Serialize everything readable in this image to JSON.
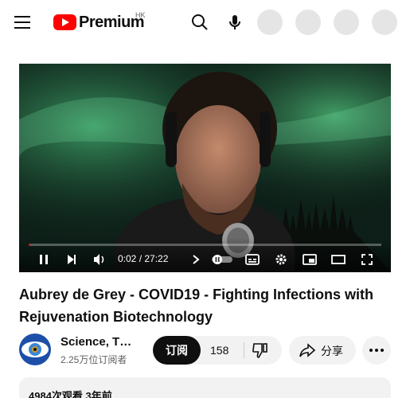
{
  "header": {
    "logo_text": "Premium",
    "region": "HK",
    "icons": [
      "menu-icon",
      "search-icon",
      "mic-icon"
    ]
  },
  "player": {
    "time": "0:02 / 27:22",
    "progress": 0.001,
    "icons": [
      "pause-icon",
      "next-icon",
      "volume-icon",
      "autoplay-toggle-icon",
      "captions-icon",
      "settings-icon",
      "miniplayer-icon",
      "theater-icon",
      "fullscreen-icon"
    ],
    "accent": "#ff0000"
  },
  "video": {
    "title": "Aubrey de Grey - COVID19 - Fighting Infections with Rejuvenation Biotechnology"
  },
  "channel": {
    "name": "Science, T…",
    "subscribers": "2.25万位订阅者",
    "subscribe_label": "订阅"
  },
  "actions": {
    "like_count": "158",
    "share_label": "分享"
  },
  "description": {
    "meta": "4984次观看  3年前"
  },
  "colors": {
    "brand": "#ff0000",
    "subscribe_bg": "#0f0f0f",
    "pill_bg": "#f2f2f2"
  }
}
